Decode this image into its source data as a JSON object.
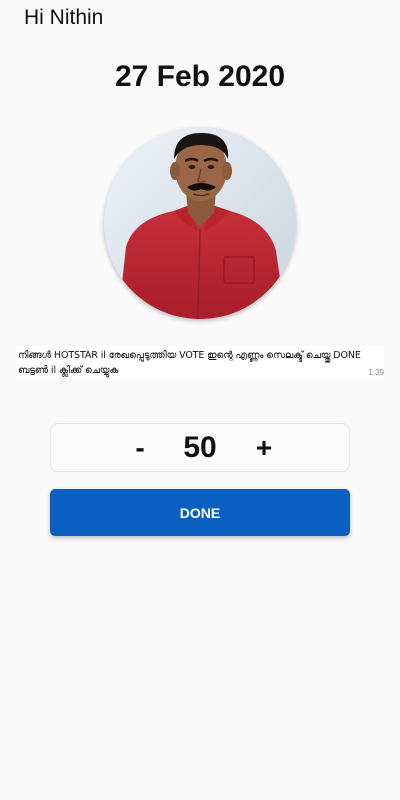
{
  "greeting": "Hi Nithin",
  "date": "27 Feb 2020",
  "profile": {
    "image": "profile-photo-man-red-shirt"
  },
  "message": {
    "text": "നിങ്ങൾ HOTSTAR il  രേഖപ്പെടുത്തിയ VOTE ഇന്റെ എണ്ണം സെലക്ട് ചെയ്തു DONE ബട്ടൺ il ക്ലിക്ക് ചെയ്യുക",
    "time": "1:39"
  },
  "stepper": {
    "minus_label": "-",
    "value": "50",
    "plus_label": "+"
  },
  "done_button": {
    "label": "DONE"
  },
  "colors": {
    "background": "#fafafa",
    "primary_button": "#0a5fc0",
    "button_text": "#ffffff"
  }
}
